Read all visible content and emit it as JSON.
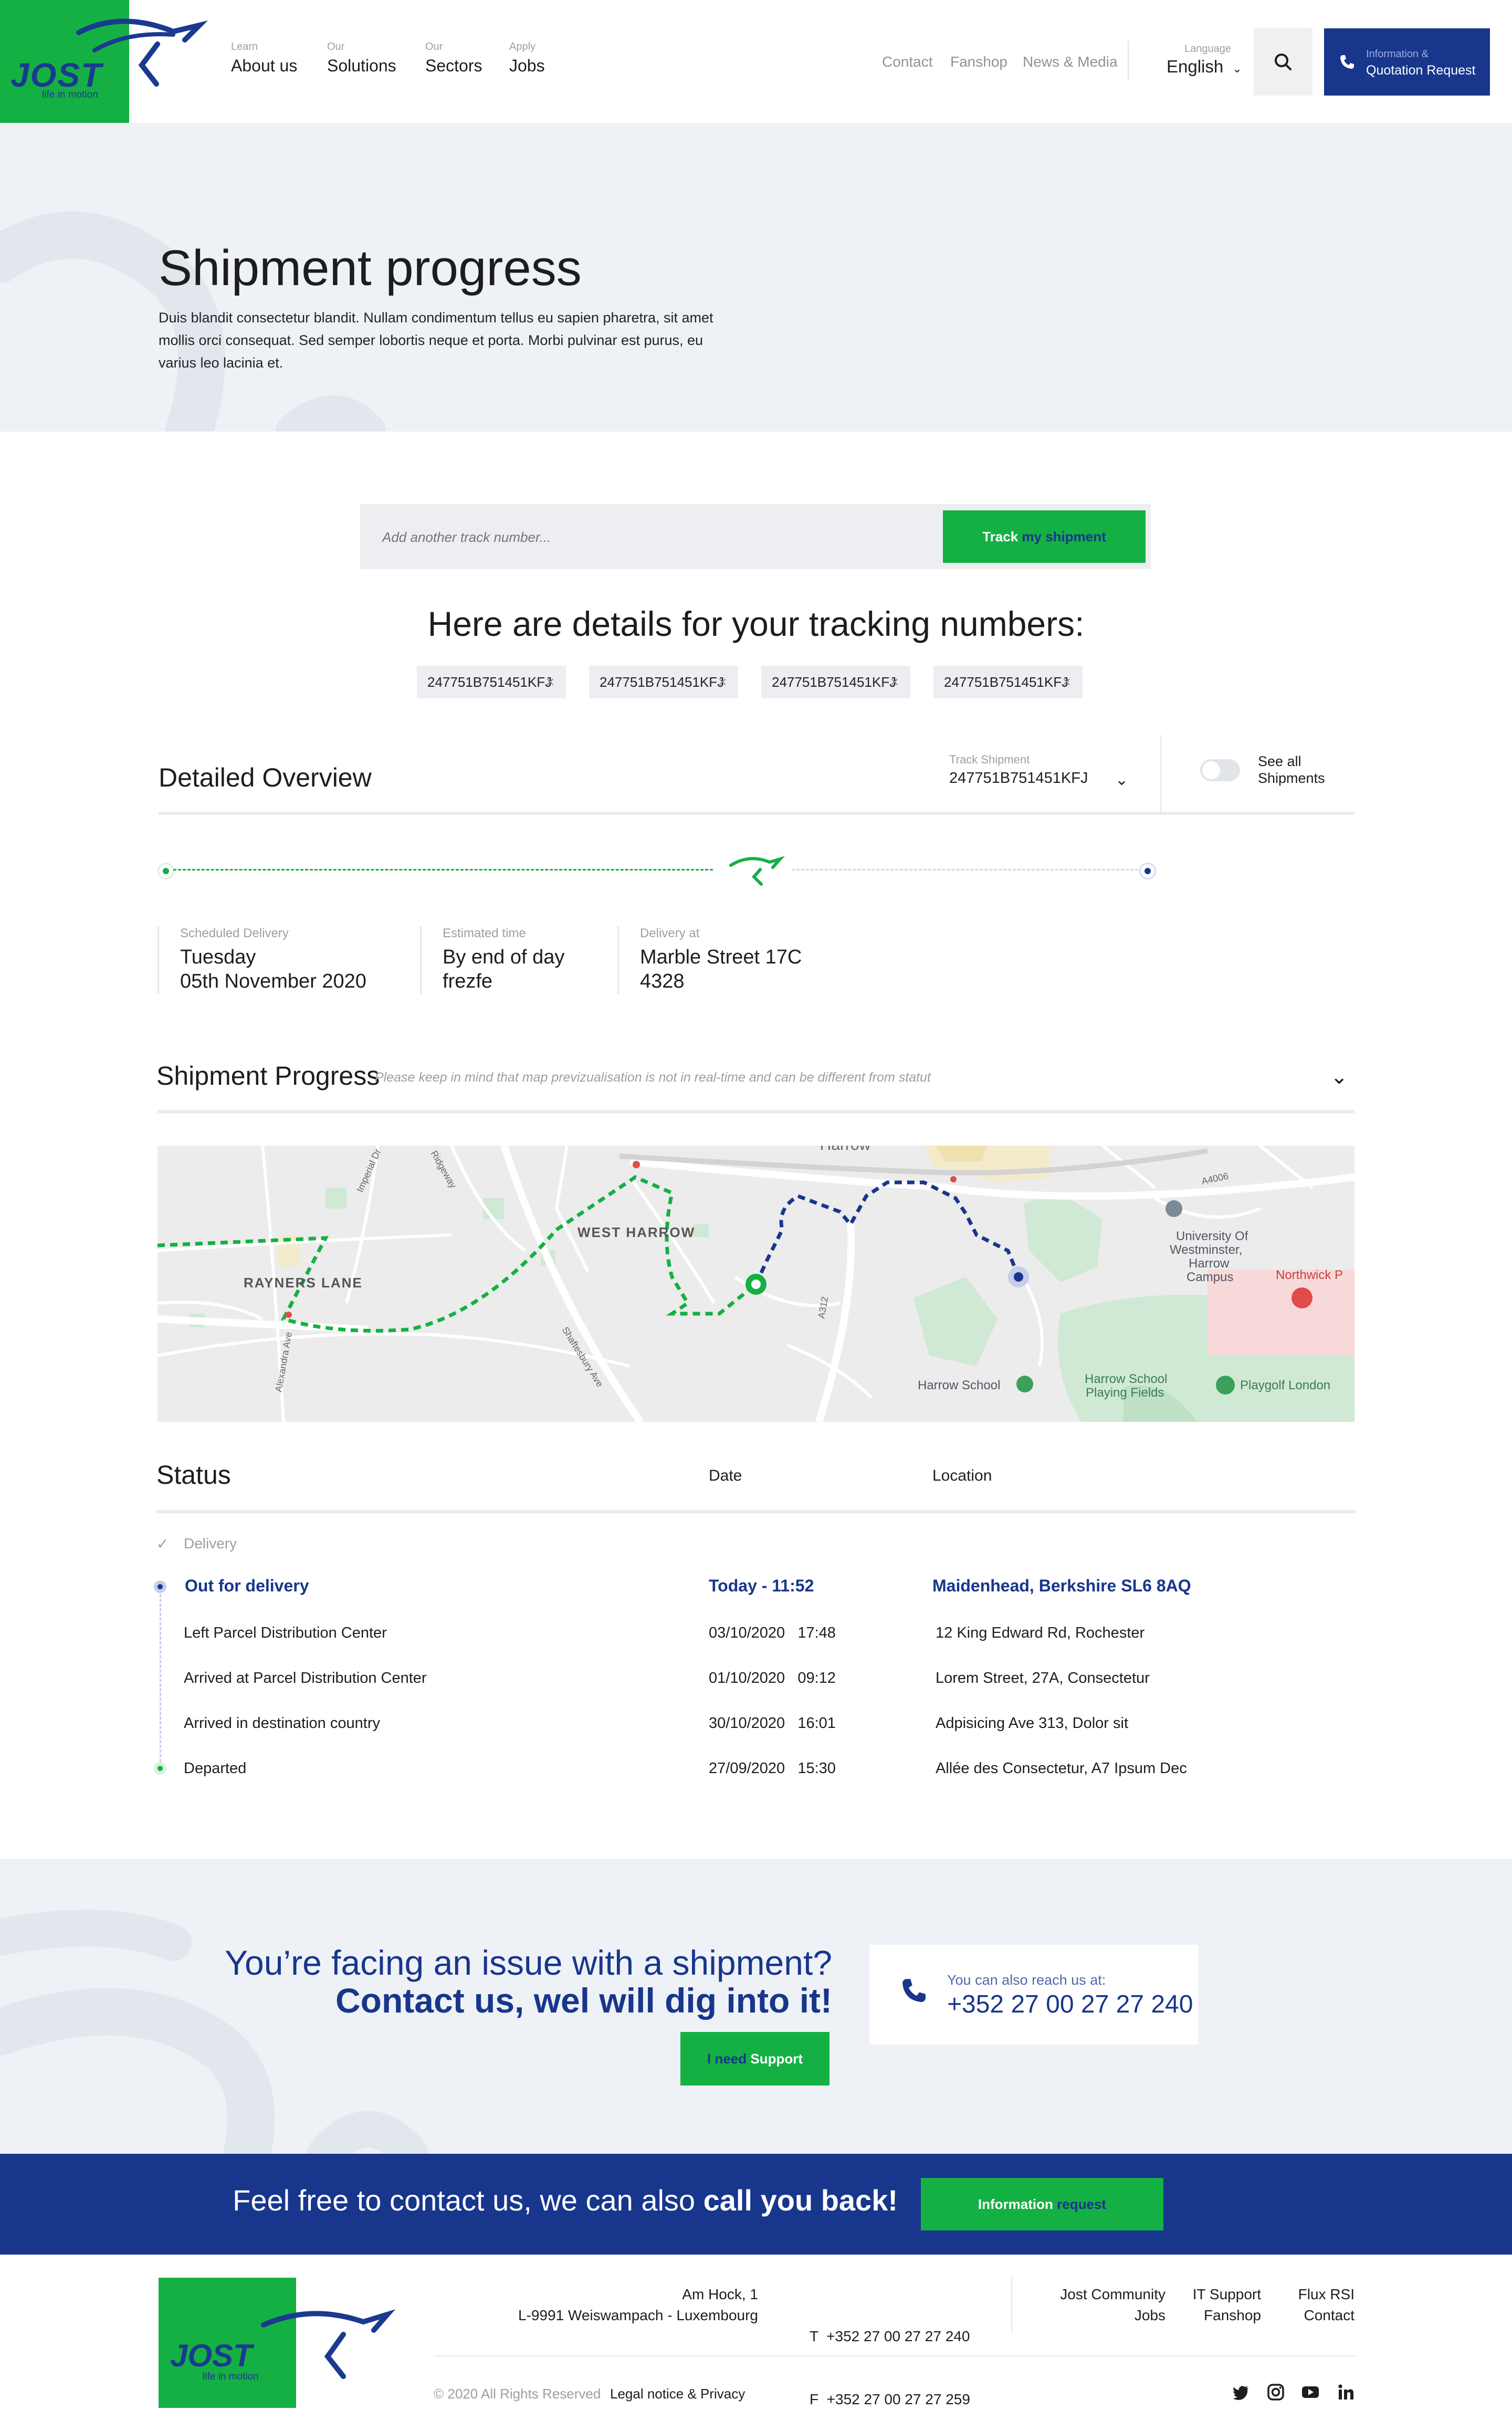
{
  "header": {
    "logo": {
      "text": "JOST",
      "tagline": "life in motion"
    },
    "nav": [
      {
        "small": "Learn",
        "label": "About us"
      },
      {
        "small": "Our",
        "label": "Solutions"
      },
      {
        "small": "Our",
        "label": "Sectors"
      },
      {
        "small": "Apply",
        "label": "Jobs"
      }
    ],
    "utility": [
      "Contact",
      "Fanshop",
      "News & Media"
    ],
    "language": {
      "label": "Language",
      "value": "English"
    },
    "quote_button": {
      "small": "Information &",
      "label": "Quotation Request"
    }
  },
  "hero": {
    "title": "Shipment progress",
    "description": "Duis blandit consectetur blandit. Nullam condimentum tellus eu sapien pharetra, sit amet mollis orci consequat. Sed semper lobortis neque et porta. Morbi pulvinar est purus, eu varius leo lacinia et."
  },
  "tracking": {
    "placeholder": "Add another track number...",
    "button_a": "Track",
    "button_b": "my shipment",
    "details_title": "Here are details for your tracking numbers:",
    "chips": [
      "247751B751451KFJ",
      "247751B751451KFJ",
      "247751B751451KFJ",
      "247751B751451KFJ"
    ],
    "chip_remove": "×"
  },
  "overview": {
    "title": "Detailed Overview",
    "track_label": "Track Shipment",
    "track_value": "247751B751451KFJ",
    "see_all": "See all Shipments",
    "progress_fraction": 0.6,
    "info": [
      {
        "label": "Scheduled Delivery",
        "line1": "Tuesday",
        "line2": "05th November 2020"
      },
      {
        "label": "Estimated time",
        "line1": "By end of day",
        "line2": "frezfe"
      },
      {
        "label": "Delivery at",
        "line1": "Marble Street 17C",
        "line2": "4328"
      }
    ]
  },
  "progress": {
    "title": "Shipment Progress",
    "note": "Please keep in mind that map previzualisation is not in real-time and can be different from statut"
  },
  "map": {
    "labels": {
      "harrow": "Harrow",
      "west_harrow": "WEST HARROW",
      "rayners_lane": "RAYNERS LANE",
      "university": [
        "University Of",
        "Westminster,",
        "Harrow",
        "Campus"
      ],
      "northwick": "Northwick P",
      "harrow_school": "Harrow School",
      "harrow_fields": [
        "Harrow School",
        "Playing Fields"
      ],
      "playgolf": "Playgolf London",
      "a4006": "A4006",
      "a312": "A312",
      "imperial": "Imperial Dr",
      "ridgeway": "Ridgeway",
      "shaftesbury": "Shaftesbury Ave",
      "alexandra": "Alexandra Ave"
    }
  },
  "status": {
    "headers": {
      "status": "Status",
      "date": "Date",
      "location": "Location"
    },
    "delivery_label": "Delivery",
    "rows": [
      {
        "status": "Out for delivery",
        "date": "Today - 11:52",
        "location": "Maidenhead, Berkshire SL6 8AQ"
      },
      {
        "status": "Left Parcel Distribution Center",
        "date": "03/10/2020   17:48",
        "location": "12 King Edward Rd, Rochester"
      },
      {
        "status": "Arrived at Parcel Distribution Center",
        "date": "01/10/2020   09:12",
        "location": "Lorem Street, 27A, Consectetur"
      },
      {
        "status": "Arrived in destination country",
        "date": "30/10/2020   16:01",
        "location": "Adpisicing Ave 313, Dolor sit"
      },
      {
        "status": "Departed",
        "date": "27/09/2020   15:30",
        "location": "Allée des Consectetur, A7 Ipsum Dec"
      }
    ]
  },
  "support": {
    "line1": "You’re facing an issue with a shipment?",
    "line2": "Contact us, wel will dig into it!",
    "button_a": "I need",
    "button_b": "Support",
    "phone_label": "You can also reach us at:",
    "phone": "+352 27 00 27 27 240"
  },
  "callback": {
    "text_a": "Feel free to contact us, we can also ",
    "text_b": "call you back!",
    "button_a": "Information",
    "button_b": "request"
  },
  "footer": {
    "address": [
      "Am Hock, 1",
      "L-9991 Weiswampach - Luxembourg"
    ],
    "phones": [
      "T  +352 27 00 27 27 240",
      "F  +352 27 00 27 27 259"
    ],
    "links_col1": [
      "Jost Community",
      "Jobs"
    ],
    "links_col2": [
      "IT Support",
      "Fanshop"
    ],
    "links_col3": [
      "Flux RSI",
      "Contact"
    ],
    "copyright": "© 2020 All Rights Reserved",
    "legal": "Legal notice & Privacy",
    "social": [
      "twitter-icon",
      "instagram-icon",
      "youtube-icon",
      "linkedin-icon"
    ]
  },
  "colors": {
    "green": "#15b043",
    "navy": "#17368c",
    "light_bg": "#eef1f5"
  }
}
